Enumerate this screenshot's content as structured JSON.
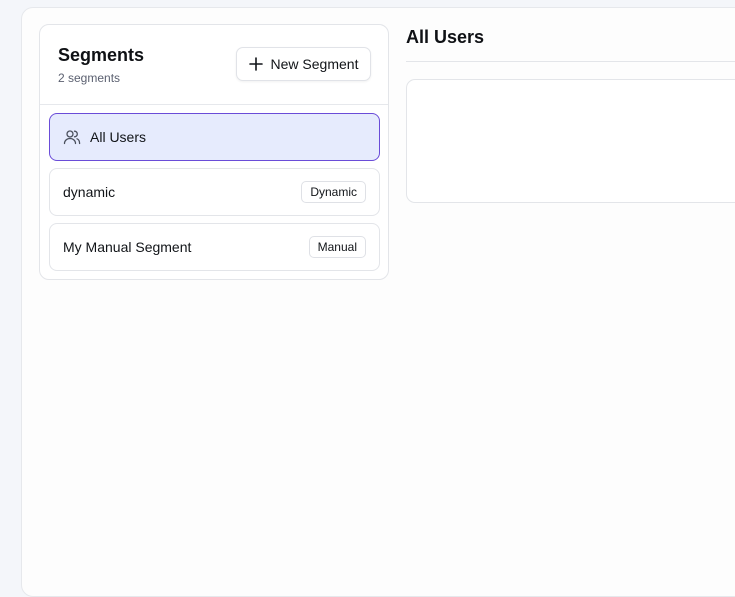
{
  "segments_panel": {
    "title": "Segments",
    "subtitle": "2 segments",
    "new_button_label": "New Segment",
    "items": [
      {
        "label": "All Users",
        "icon": "users-icon",
        "badge": ""
      },
      {
        "label": "dynamic",
        "badge": "Dynamic"
      },
      {
        "label": "My Manual Segment",
        "badge": "Manual"
      }
    ]
  },
  "detail": {
    "title": "All Users"
  },
  "colors": {
    "accent_border": "#6a4cd8",
    "active_bg": "#e6ebfd"
  }
}
